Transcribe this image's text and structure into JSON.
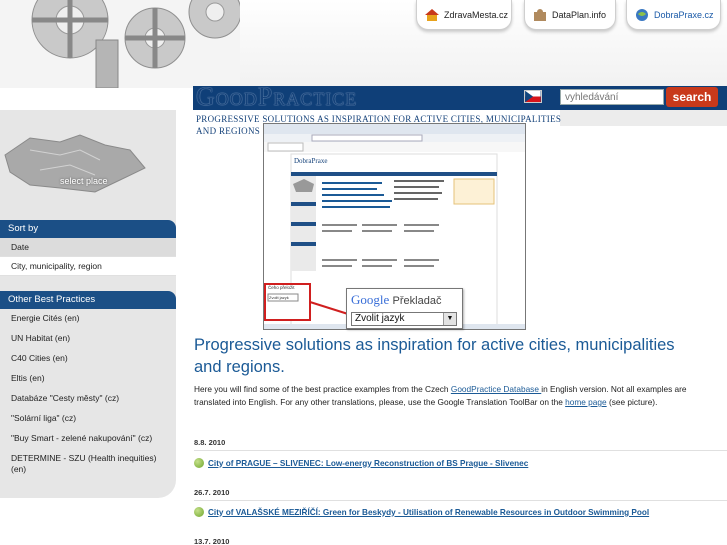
{
  "top_tabs": [
    {
      "label": "ZdravaMesta.cz",
      "icon": "house-icon"
    },
    {
      "label": "DataPlan.info",
      "icon": "puzzle-icon"
    },
    {
      "label": "DobraPraxe.cz",
      "icon": "globe-icon"
    }
  ],
  "header": {
    "logo": "GoodPractice",
    "subtitle": "Progressive solutions as inspiration for active cities, municipalities and regions",
    "search_placeholder": "vyhledávání",
    "search_button": "search"
  },
  "sidebar": {
    "select_place": "select place",
    "sort_by_title": "Sort by",
    "sort_items": [
      "Date",
      "City, municipality, region"
    ],
    "other_title": "Other Best Practices",
    "other_items": [
      "Energie Cités (en)",
      "UN Habitat (en)",
      "C40 Cities (en)",
      "Eltis (en)",
      "Databáze \"Cesty městy\" (cz)",
      "\"Solární liga\" (cz)",
      "\"Buy Smart - zelené nakupování\" (cz)",
      "DETERMINE - SZU (Health inequities) (en)"
    ]
  },
  "picture": {
    "mini_logo": "DobraPraxe",
    "mini_dropdown_label": "Zvolit jazyk",
    "mini_translate_label": "Čeho přeložit",
    "translate_brand": "Google",
    "translate_word": "Překladač",
    "translate_select": "Zvolit jazyk"
  },
  "main": {
    "title": "Progressive solutions as inspiration for active cities, municipalities and regions.",
    "intro_before": "Here you will find some of the best practice examples from the Czech ",
    "intro_link1": "GoodPractice Database ",
    "intro_middle": "in English version. Not all examples are translated into English. For any other translations, please, use the Google Translation ToolBar on the ",
    "intro_link2": "home page",
    "intro_after": " (see picture)."
  },
  "news": [
    {
      "date": "8.8. 2010",
      "title": "City of PRAGUE – SLIVENEC: Low-energy Reconstruction of BS Prague - Slivenec"
    },
    {
      "date": "26.7. 2010",
      "title": "City of VALAŠSKÉ MEZIŘÍČÍ: Green for Beskydy - Utilisation of Renewable Resources in Outdoor Swimming Pool"
    },
    {
      "date": "13.7. 2010",
      "title": ""
    }
  ],
  "colors": {
    "brand_blue": "#0f3f78",
    "link_blue": "#1b5a96",
    "search_red": "#c8391b"
  }
}
